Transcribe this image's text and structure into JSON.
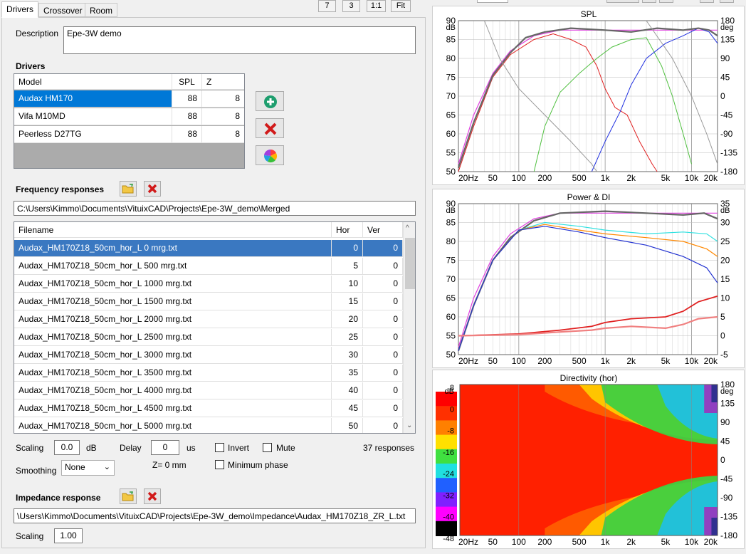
{
  "tabs": [
    {
      "label": "Drivers"
    },
    {
      "label": "Crossover"
    },
    {
      "label": "Room"
    }
  ],
  "toolbar": {
    "b1": "7",
    "b2": "3",
    "b3": "1:1",
    "b4": "Fit"
  },
  "description": {
    "label": "Description",
    "value": "Epe-3W demo"
  },
  "drivers": {
    "title": "Drivers",
    "headers": {
      "model": "Model",
      "spl": "SPL",
      "z": "Z"
    },
    "rows": [
      {
        "model": "Audax HM170",
        "spl": "88",
        "z": "8"
      },
      {
        "model": "Vifa M10MD",
        "spl": "88",
        "z": "8"
      },
      {
        "model": "Peerless D27TG",
        "spl": "88",
        "z": "8"
      }
    ]
  },
  "freq": {
    "title": "Frequency responses",
    "path": "C:\\Users\\Kimmo\\Documents\\VituixCAD\\Projects\\Epe-3W_demo\\Merged",
    "headers": {
      "file": "Filename",
      "hor": "Hor",
      "ver": "Ver"
    },
    "rows": [
      {
        "file": "Audax_HM170Z18_50cm_hor_L 0 mrg.txt",
        "hor": "0",
        "ver": "0"
      },
      {
        "file": "Audax_HM170Z18_50cm_hor_L 500 mrg.txt",
        "hor": "5",
        "ver": "0"
      },
      {
        "file": "Audax_HM170Z18_50cm_hor_L 1000 mrg.txt",
        "hor": "10",
        "ver": "0"
      },
      {
        "file": "Audax_HM170Z18_50cm_hor_L 1500 mrg.txt",
        "hor": "15",
        "ver": "0"
      },
      {
        "file": "Audax_HM170Z18_50cm_hor_L 2000 mrg.txt",
        "hor": "20",
        "ver": "0"
      },
      {
        "file": "Audax_HM170Z18_50cm_hor_L 2500 mrg.txt",
        "hor": "25",
        "ver": "0"
      },
      {
        "file": "Audax_HM170Z18_50cm_hor_L 3000 mrg.txt",
        "hor": "30",
        "ver": "0"
      },
      {
        "file": "Audax_HM170Z18_50cm_hor_L 3500 mrg.txt",
        "hor": "35",
        "ver": "0"
      },
      {
        "file": "Audax_HM170Z18_50cm_hor_L 4000 mrg.txt",
        "hor": "40",
        "ver": "0"
      },
      {
        "file": "Audax_HM170Z18_50cm_hor_L 4500 mrg.txt",
        "hor": "45",
        "ver": "0"
      },
      {
        "file": "Audax_HM170Z18_50cm_hor_L 5000 mrg.txt",
        "hor": "50",
        "ver": "0"
      }
    ],
    "scaling_label": "Scaling",
    "scaling": "0.0",
    "db": "dB",
    "delay_label": "Delay",
    "delay": "0",
    "us": "us",
    "invert": "Invert",
    "mute": "Mute",
    "count": "37 responses",
    "smoothing_label": "Smoothing",
    "smoothing": "None",
    "zmm": "Z= 0 mm",
    "minphase": "Minimum phase"
  },
  "imp": {
    "title": "Impedance response",
    "path": "\\Users\\Kimmo\\Documents\\VituixCAD\\Projects\\Epe-3W_demo\\Impedance\\Audax_HM170Z18_ZR_L.txt",
    "scaling_label": "Scaling",
    "scaling": "1.00"
  },
  "charts": {
    "spl": {
      "title": "SPL",
      "unit_l": "dB",
      "unit_r": "deg",
      "yl": [
        "90",
        "85",
        "80",
        "75",
        "70",
        "65",
        "60",
        "55",
        "50"
      ],
      "yr": [
        "180",
        "135",
        "90",
        "45",
        "0",
        "-45",
        "-90",
        "-135",
        "-180"
      ],
      "x": [
        "20Hz",
        "50",
        "100",
        "200",
        "500",
        "1k",
        "2k",
        "5k",
        "10k",
        "20k"
      ]
    },
    "power": {
      "title": "Power & DI",
      "unit_l": "dB",
      "unit_r": "dB",
      "yl": [
        "90",
        "85",
        "80",
        "75",
        "70",
        "65",
        "60",
        "55",
        "50"
      ],
      "yr": [
        "35",
        "30",
        "25",
        "20",
        "15",
        "10",
        "5",
        "0",
        "-5"
      ],
      "x": [
        "20Hz",
        "50",
        "100",
        "200",
        "500",
        "1k",
        "2k",
        "5k",
        "10k",
        "20k"
      ]
    },
    "dir": {
      "title": "Directivity (hor)",
      "unit_l": "dB",
      "unit_r": "deg",
      "yl": [
        "8",
        "0",
        "-8",
        "-16",
        "-24",
        "-32",
        "-40",
        "-48"
      ],
      "yr": [
        "180",
        "135",
        "90",
        "45",
        "0",
        "-45",
        "-90",
        "-135",
        "-180"
      ],
      "x": [
        "20Hz",
        "50",
        "100",
        "200",
        "500",
        "1k",
        "2k",
        "5k",
        "10k",
        "20k"
      ]
    }
  }
}
